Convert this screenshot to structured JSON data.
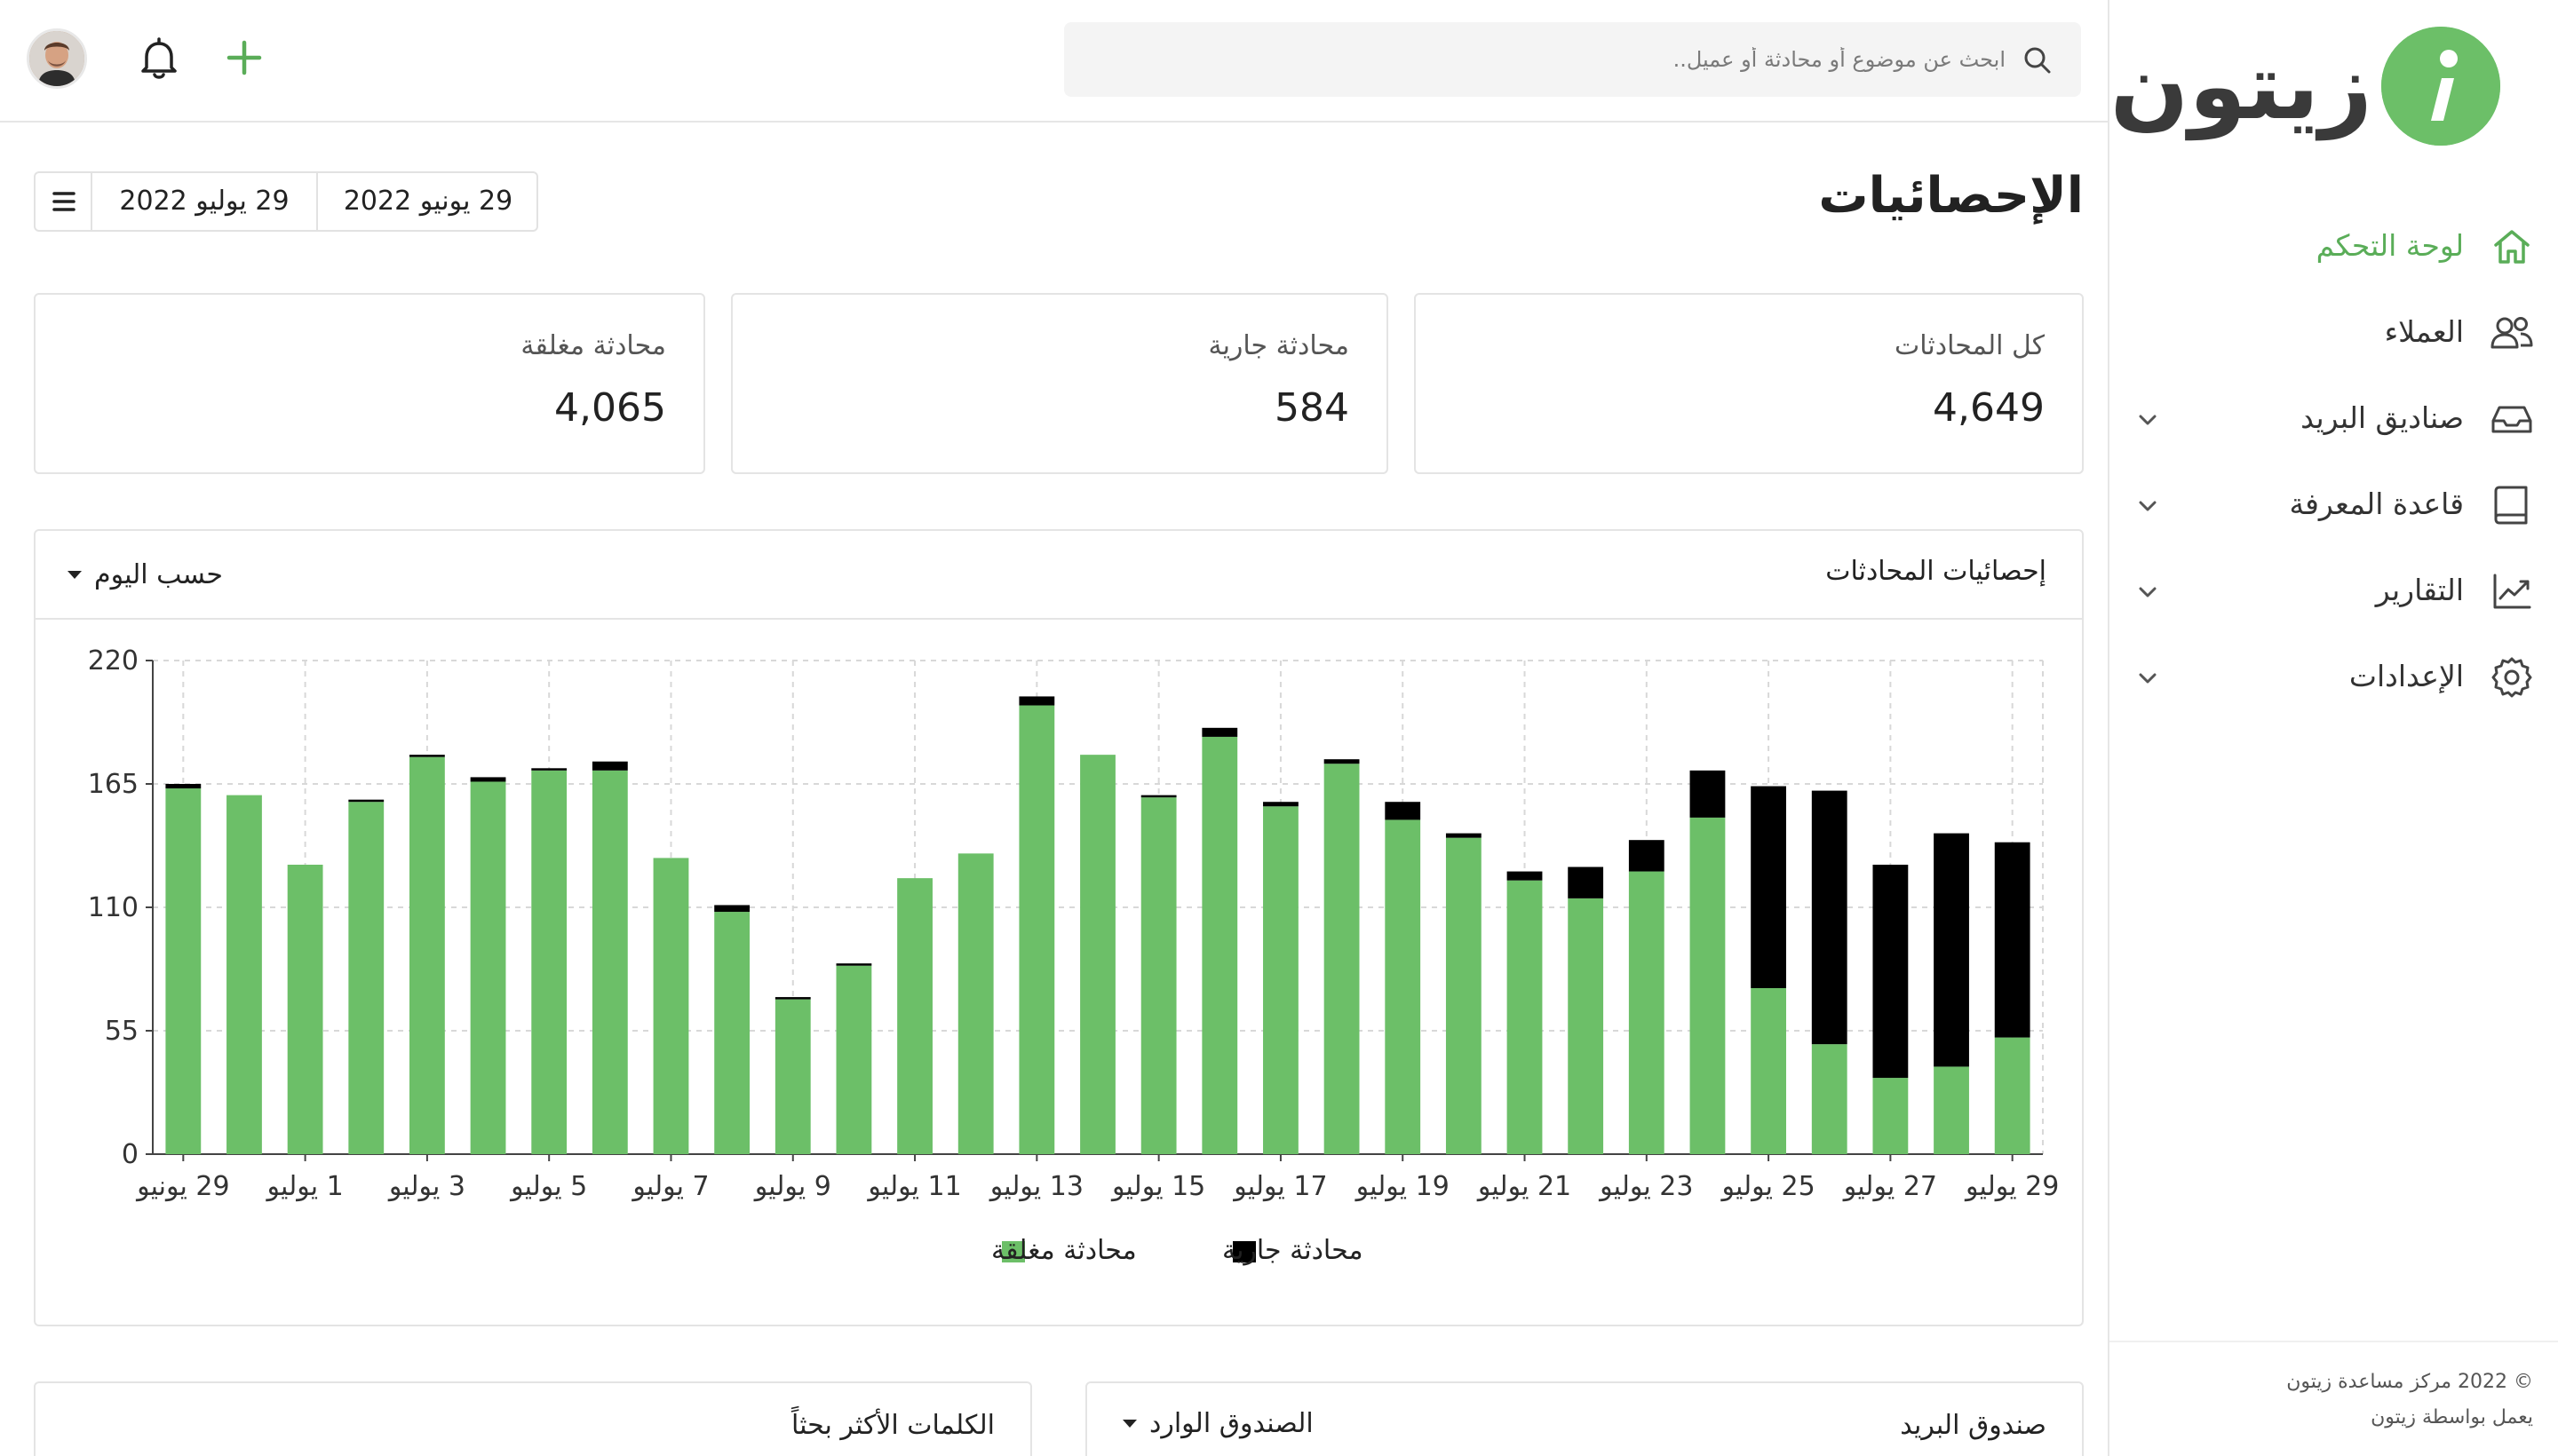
{
  "brand": {
    "name": "زيتون",
    "accent": "#6cbf68",
    "dark": "#3a3a3a"
  },
  "search": {
    "placeholder": "ابحث عن موضوع أو محادثة أو عميل.."
  },
  "sidebar": {
    "items": [
      {
        "label": "لوحة التحكم",
        "icon": "home-icon",
        "active": true,
        "has_chevron": false
      },
      {
        "label": "العملاء",
        "icon": "users-icon",
        "active": false,
        "has_chevron": false
      },
      {
        "label": "صناديق البريد",
        "icon": "inbox-icon",
        "active": false,
        "has_chevron": true
      },
      {
        "label": "قاعدة المعرفة",
        "icon": "book-icon",
        "active": false,
        "has_chevron": true
      },
      {
        "label": "التقارير",
        "icon": "chart-line-icon",
        "active": false,
        "has_chevron": true
      },
      {
        "label": "الإعدادات",
        "icon": "gear-icon",
        "active": false,
        "has_chevron": true
      }
    ],
    "footer": {
      "copyright": "© 2022 مركز مساعدة زيتون",
      "powered": "يعمل بواسطة زيتون"
    }
  },
  "page": {
    "title": "الإحصائيات",
    "date_start": "29 يونيو 2022",
    "date_end": "29 يوليو 2022"
  },
  "stats": [
    {
      "label": "كل المحادثات",
      "value": "4,649"
    },
    {
      "label": "محادثة جارية",
      "value": "584"
    },
    {
      "label": "محادثة مغلقة",
      "value": "4,065"
    }
  ],
  "conversations_panel": {
    "title": "إحصائيات المحادثات",
    "group_by": "حسب اليوم"
  },
  "chart_data": {
    "type": "bar",
    "stacked": true,
    "y_ticks": [
      "0",
      "55",
      "110",
      "165",
      "220"
    ],
    "ylim": [
      0,
      220
    ],
    "grid": true,
    "legend_placement": "bottom-center",
    "x_tick_labels": [
      "29 يونيو",
      "1 يوليو",
      "3 يوليو",
      "5 يوليو",
      "7 يوليو",
      "9 يوليو",
      "11 يوليو",
      "13 يوليو",
      "15 يوليو",
      "17 يوليو",
      "19 يوليو",
      "21 يوليو",
      "23 يوليو",
      "25 يوليو",
      "27 يوليو",
      "29 يوليو"
    ],
    "categories": [
      "29 يونيو",
      "30 يونيو",
      "1 يوليو",
      "2 يوليو",
      "3 يوليو",
      "4 يوليو",
      "5 يوليو",
      "6 يوليو",
      "7 يوليو",
      "8 يوليو",
      "9 يوليو",
      "10 يوليو",
      "11 يوليو",
      "12 يوليو",
      "13 يوليو",
      "14 يوليو",
      "15 يوليو",
      "16 يوليو",
      "17 يوليو",
      "18 يوليو",
      "19 يوليو",
      "20 يوليو",
      "21 يوليو",
      "22 يوليو",
      "23 يوليو",
      "24 يوليو",
      "25 يوليو",
      "26 يوليو",
      "27 يوليو",
      "28 يوليو",
      "29 يوليو"
    ],
    "series": [
      {
        "name": "محادثة مغلقة",
        "color": "#6cbf68",
        "values": [
          163,
          160,
          129,
          157,
          177,
          166,
          171,
          171,
          132,
          108,
          69,
          84,
          123,
          134,
          200,
          178,
          159,
          186,
          155,
          174,
          149,
          141,
          122,
          114,
          126,
          150,
          74,
          49,
          34,
          39,
          52
        ]
      },
      {
        "name": "محادثة جارية",
        "color": "#000000",
        "values": [
          2,
          0,
          0,
          1,
          1,
          2,
          1,
          4,
          0,
          3,
          1,
          1,
          0,
          0,
          4,
          0,
          1,
          4,
          2,
          2,
          8,
          2,
          4,
          14,
          14,
          21,
          90,
          113,
          95,
          104,
          87
        ]
      }
    ]
  },
  "bottom_cards": {
    "mailbox": {
      "title": "صندوق البريد",
      "select": "الصندوق الوارد"
    },
    "keywords": {
      "title": "الكلمات الأكثر بحثاً"
    }
  }
}
